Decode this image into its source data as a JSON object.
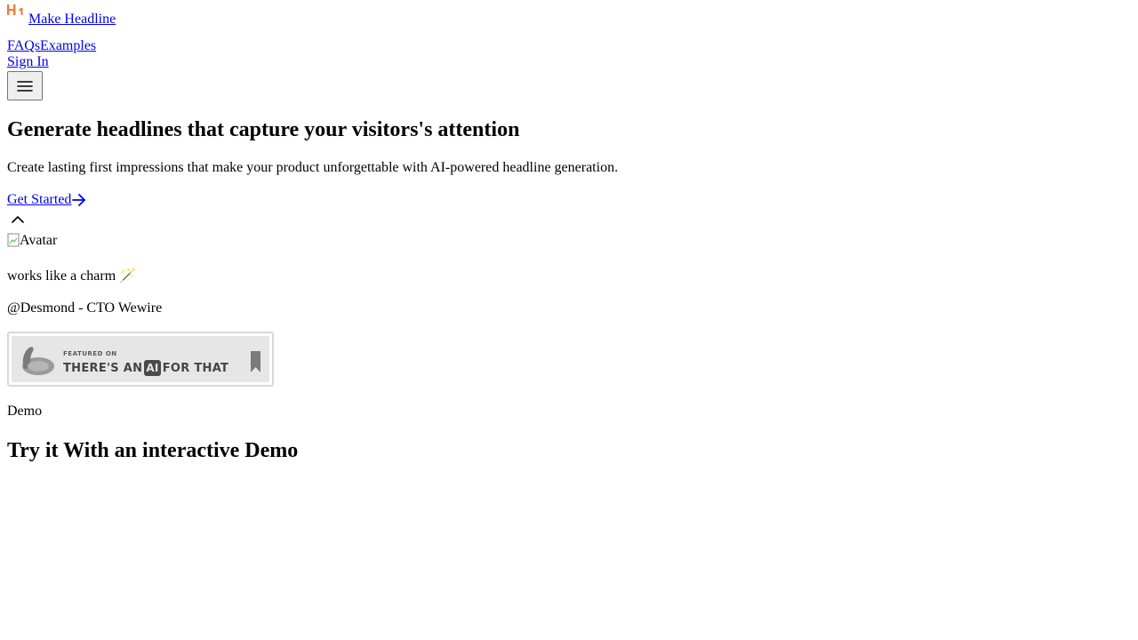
{
  "header": {
    "logo_icon": "h1-heading-icon",
    "brand_label": "Make Headline",
    "accent_color": "#f07a3a",
    "nav": [
      {
        "label": "FAQs"
      },
      {
        "label": "Examples"
      }
    ],
    "signin_label": "Sign In",
    "menu_icon": "hamburger-menu-icon"
  },
  "hero": {
    "title": "Generate headlines that capture your visitors's attention",
    "subtitle": "Create lasting first impressions that make your product unforgettable with AI-powered headline generation.",
    "cta_label": "Get Started",
    "cta_icon": "arrow-right-icon",
    "scroll_icon": "chevron-up-icon"
  },
  "testimonial": {
    "avatar_alt": "Avatar",
    "quote": "works like a charm 🪄",
    "author": "@Desmond - CTO Wewire"
  },
  "badge": {
    "small_text": "FEATURED ON",
    "main_prefix": "THERE'S AN",
    "main_ai": "AI",
    "main_suffix": "FOR THAT"
  },
  "demo": {
    "label": "Demo",
    "title": "Try it With an interactive Demo"
  }
}
